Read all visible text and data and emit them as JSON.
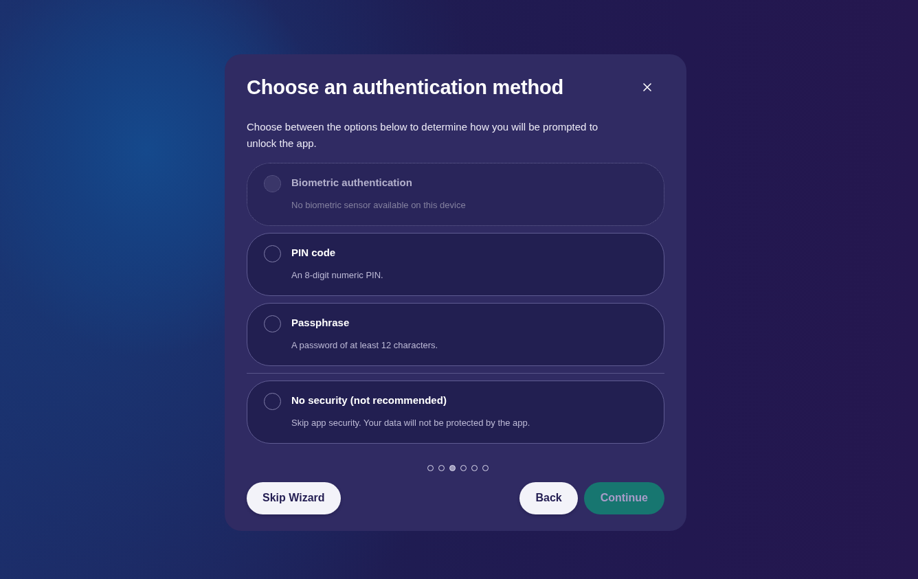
{
  "dialog": {
    "title": "Choose an authentication method",
    "description": "Choose between the options below to determine how you will be prompted to unlock the app.",
    "option_groups": [
      {
        "options": [
          {
            "label": "Biometric authentication",
            "description": "No biometric sensor available on this device",
            "selected": false,
            "disabled": true
          },
          {
            "label": "PIN code",
            "description": "An 8-digit numeric PIN.",
            "selected": false,
            "disabled": false
          },
          {
            "label": "Passphrase",
            "description": "A password of at least 12 characters.",
            "selected": false,
            "disabled": false
          }
        ]
      },
      {
        "options": [
          {
            "label": "No security (not recommended)",
            "description": "Skip app security. Your data will not be protected by the app.",
            "selected": false,
            "disabled": false
          }
        ]
      }
    ],
    "steps": [
      {
        "selected": false
      },
      {
        "selected": false
      },
      {
        "selected": true
      },
      {
        "selected": false
      },
      {
        "selected": false
      },
      {
        "selected": false
      }
    ],
    "footer": {
      "start_buttons": [
        {
          "label": "Skip Wizard",
          "kind": "secondary",
          "disabled": false
        }
      ],
      "end_buttons": [
        {
          "label": "Back",
          "kind": "secondary",
          "disabled": false
        },
        {
          "label": "Continue",
          "kind": "primary",
          "disabled": true
        }
      ]
    }
  }
}
